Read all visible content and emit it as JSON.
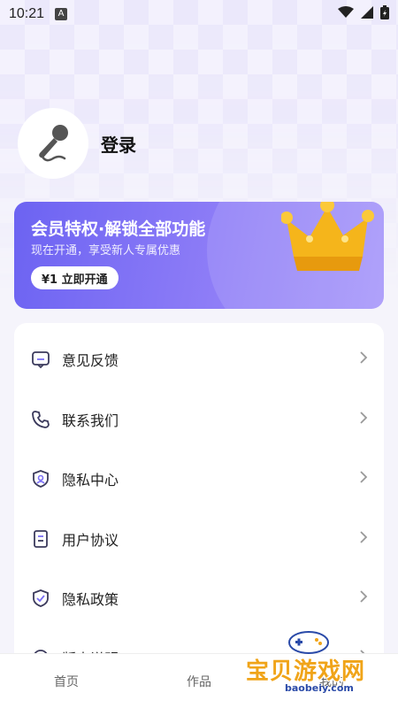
{
  "status_bar": {
    "time": "10:21",
    "notif_letter": "A"
  },
  "profile": {
    "login_label": "登录"
  },
  "vip": {
    "title": "会员特权·解锁全部功能",
    "subtitle": "现在开通，享受新人专属优惠",
    "button_label": "¥1 立即开通"
  },
  "menu": {
    "items": [
      {
        "label": "意见反馈",
        "icon": "message-icon"
      },
      {
        "label": "联系我们",
        "icon": "phone-icon"
      },
      {
        "label": "隐私中心",
        "icon": "shield-user-icon"
      },
      {
        "label": "用户协议",
        "icon": "document-icon"
      },
      {
        "label": "隐私政策",
        "icon": "shield-check-icon"
      },
      {
        "label": "版本说明",
        "icon": "info-icon"
      }
    ]
  },
  "tabbar": {
    "tabs": [
      {
        "label": "首页"
      },
      {
        "label": "作品"
      },
      {
        "label": "我的"
      }
    ]
  },
  "watermark": {
    "text": "宝贝游戏网",
    "url": "baobeiy.com"
  },
  "colors": {
    "accent": "#7b6ff5",
    "crown": "#f5b51b",
    "icon": "#3b3a5c"
  }
}
